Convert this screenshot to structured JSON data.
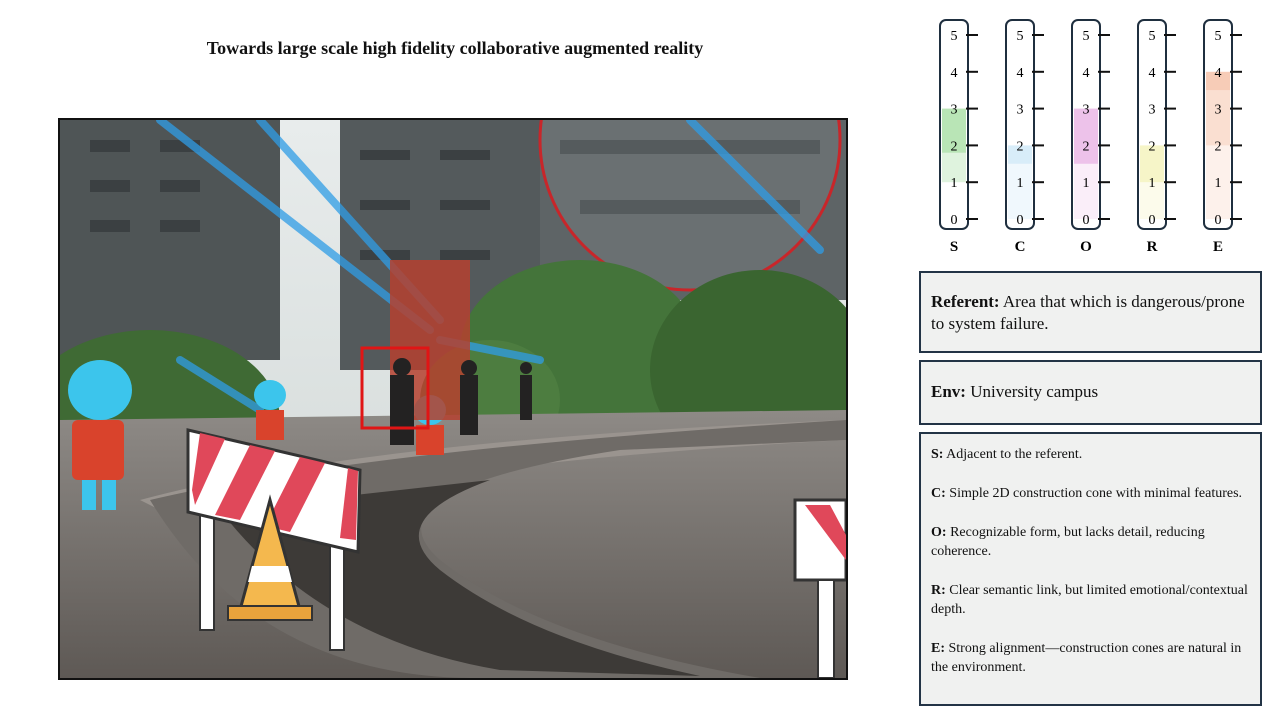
{
  "title": "Towards large scale high fidelity collaborative augmented reality",
  "scales": {
    "ticks": [
      "0",
      "1",
      "2",
      "3",
      "4",
      "5"
    ],
    "items": [
      {
        "key": "S",
        "color": "#7fcf7a",
        "fill": [
          [
            1,
            1.8,
            0.25
          ],
          [
            1.8,
            3.0,
            0.55
          ]
        ]
      },
      {
        "key": "C",
        "color": "#9dd3f0",
        "fill": [
          [
            0,
            1.5,
            0.15
          ],
          [
            1.5,
            2.0,
            0.4
          ]
        ]
      },
      {
        "key": "O",
        "color": "#de8fd8",
        "fill": [
          [
            0,
            1.5,
            0.15
          ],
          [
            1.5,
            3.0,
            0.55
          ]
        ]
      },
      {
        "key": "R",
        "color": "#efec9a",
        "fill": [
          [
            0,
            1.0,
            0.2
          ],
          [
            1.0,
            2.0,
            0.55
          ]
        ]
      },
      {
        "key": "E",
        "color": "#f0a27c",
        "fill": [
          [
            0,
            2.0,
            0.15
          ],
          [
            2.0,
            3.5,
            0.35
          ],
          [
            3.5,
            4.0,
            0.55
          ]
        ]
      }
    ]
  },
  "referent": {
    "label": "Referent:",
    "text": " Area that which is dangerous/prone to system failure."
  },
  "env": {
    "label": "Env:",
    "text": " University campus"
  },
  "descriptions": [
    {
      "label": "S:",
      "text": " Adjacent to the referent."
    },
    {
      "label": "C:",
      "text": " Simple 2D construction cone with minimal features."
    },
    {
      "label": "O:",
      "text": " Recognizable form, but lacks detail, reducing coherence."
    },
    {
      "label": "R:",
      "text": " Clear semantic link, but limited emotional/contextual depth."
    },
    {
      "label": "E:",
      "text": " Strong alignment—construction cones are natural in the environment."
    }
  ]
}
